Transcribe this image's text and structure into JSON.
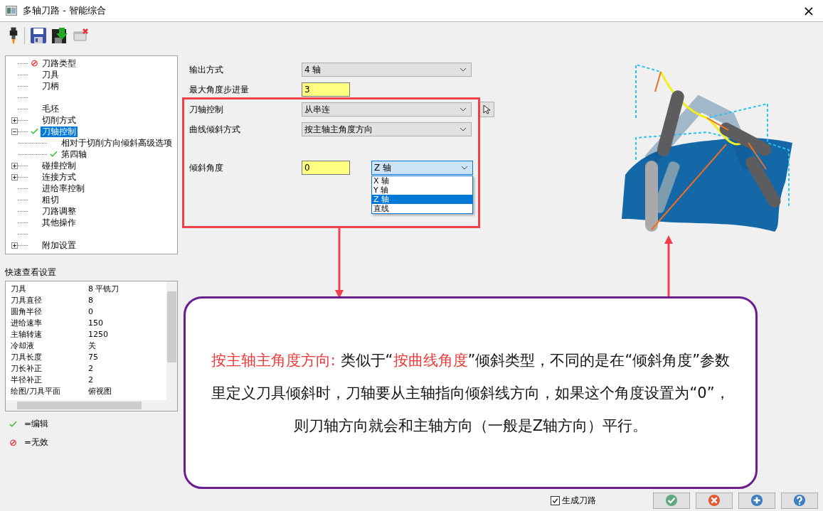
{
  "window": {
    "title": "多轴刀路 - 智能综合",
    "close": "×"
  },
  "tree": [
    {
      "kind": "invalid",
      "label": "刀路类型",
      "selected": false
    },
    {
      "kind": "plain",
      "label": "刀具",
      "selected": false
    },
    {
      "kind": "plain",
      "label": "刀柄",
      "selected": false
    },
    {
      "kind": "spacer"
    },
    {
      "kind": "plain",
      "label": "毛坯",
      "selected": false
    },
    {
      "kind": "plain",
      "label": "切削方式",
      "expanded": false,
      "selected": false
    },
    {
      "kind": "edited",
      "label": "刀轴控制",
      "expanded": true,
      "selected": true,
      "children": [
        {
          "kind": "plain",
          "label": "相对于切削方向倾斜高级选项",
          "selected": false
        },
        {
          "kind": "edited",
          "label": "第四轴",
          "selected": false
        }
      ]
    },
    {
      "kind": "plain",
      "label": "碰撞控制",
      "expanded": false,
      "selected": false
    },
    {
      "kind": "plain",
      "label": "连接方式",
      "expanded": false,
      "selected": false
    },
    {
      "kind": "plain",
      "label": "进给率控制",
      "selected": false
    },
    {
      "kind": "plain",
      "label": "粗切",
      "selected": false
    },
    {
      "kind": "plain",
      "label": "刀路调整",
      "selected": false
    },
    {
      "kind": "plain",
      "label": "其他操作",
      "selected": false
    },
    {
      "kind": "spacer"
    },
    {
      "kind": "plain",
      "label": "附加设置",
      "expanded": false,
      "selected": false
    }
  ],
  "quick_view": {
    "title": "快速查看设置",
    "rows": [
      [
        "刀具",
        "8 平铣刀"
      ],
      [
        "刀具直径",
        "8"
      ],
      [
        "圆角半径",
        "0"
      ],
      [
        "进给速率",
        "150"
      ],
      [
        "主轴转速",
        "1250"
      ],
      [
        "冷却液",
        "关"
      ],
      [
        "刀具长度",
        "75"
      ],
      [
        "刀长补正",
        "2"
      ],
      [
        "半径补正",
        "2"
      ],
      [
        "绘图/刀具平面",
        "俯视图"
      ]
    ]
  },
  "legend": [
    {
      "kind": "edited",
      "label": "=编辑"
    },
    {
      "kind": "invalid",
      "label": "=无效"
    }
  ],
  "form": [
    {
      "label": "输出方式",
      "kind": "select",
      "value": "4 轴"
    },
    {
      "label": "最大角度步进量",
      "kind": "input",
      "value": "3"
    },
    {
      "label": "刀轴控制",
      "kind": "select-button",
      "value": "从串连"
    },
    {
      "label": "曲线倾斜方式",
      "kind": "select",
      "value": "按主轴主角度方向"
    },
    {
      "label": "倾斜角度",
      "kind": "input-dropdown",
      "value": "0",
      "dropdown": {
        "value": "Z 轴",
        "options": [
          {
            "label": "X 轴",
            "selected": false
          },
          {
            "label": "Y 轴",
            "selected": false
          },
          {
            "label": "Z 轴",
            "selected": true
          },
          {
            "label": "直线",
            "selected": false
          }
        ]
      }
    }
  ],
  "callout": [
    {
      "text": "按主轴主角度方向: ",
      "highlight": true
    },
    {
      "text": "类似于“",
      "highlight": false
    },
    {
      "text": "按曲线角度",
      "highlight": true
    },
    {
      "text": "”倾斜类型，不同的是在“倾斜角度”参数里定义刀具倾斜时，刀轴要从主轴指向倾斜线方向，如果这个角度设置为“0”，则刀轴方向就会和主轴方向（一般是Z轴方向）平行。",
      "highlight": false
    }
  ],
  "generate_toolpath": {
    "label": "生成刀路",
    "checked": true
  },
  "buttons": [
    {
      "kind": "ok"
    },
    {
      "kind": "cancel"
    },
    {
      "kind": "add"
    },
    {
      "kind": "help"
    }
  ]
}
